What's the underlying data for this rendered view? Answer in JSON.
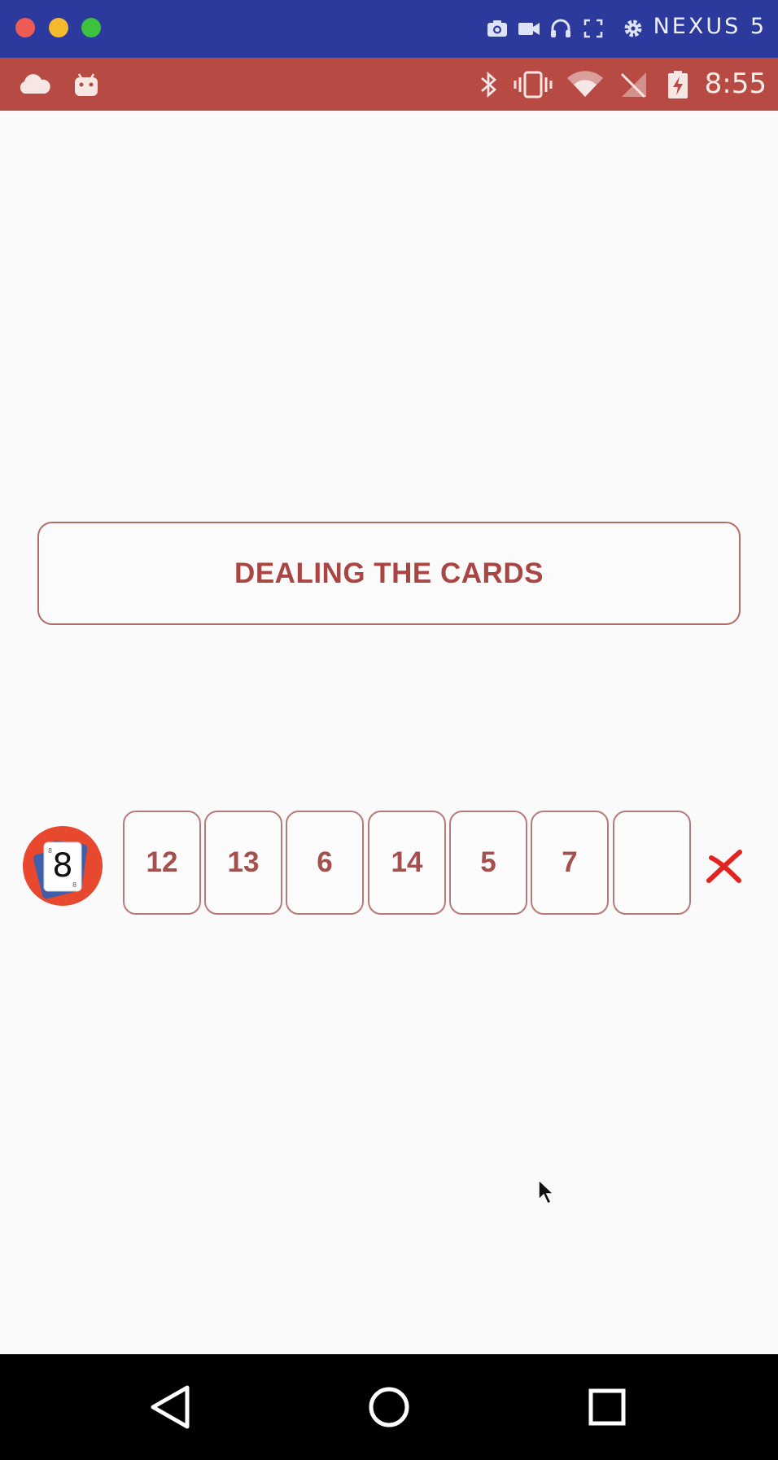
{
  "emulator": {
    "device_name": "NEXUS 5",
    "toolbar_icons": [
      "camera-icon",
      "video-icon",
      "headphones-icon",
      "fullscreen-icon",
      "gear-icon"
    ]
  },
  "status_bar": {
    "time": "8:55",
    "left_icons": [
      "cloud-icon",
      "android-icon"
    ],
    "right_icons": [
      "bluetooth-icon",
      "vibrate-icon",
      "wifi-icon",
      "no-signal-icon",
      "battery-charging-icon"
    ]
  },
  "main": {
    "action_button_label": "DEALING THE CARDS",
    "deck_count": "8",
    "cards": [
      "12",
      "13",
      "6",
      "14",
      "5",
      "7",
      ""
    ]
  },
  "nav": {
    "buttons": [
      "back-icon",
      "home-icon",
      "recents-icon"
    ]
  },
  "colors": {
    "emulator_bar": "#2b3a9c",
    "status_bar": "#b84a44",
    "accent": "#a94644",
    "clear_red": "#e3231f",
    "avatar_bg": "#e8492e"
  }
}
